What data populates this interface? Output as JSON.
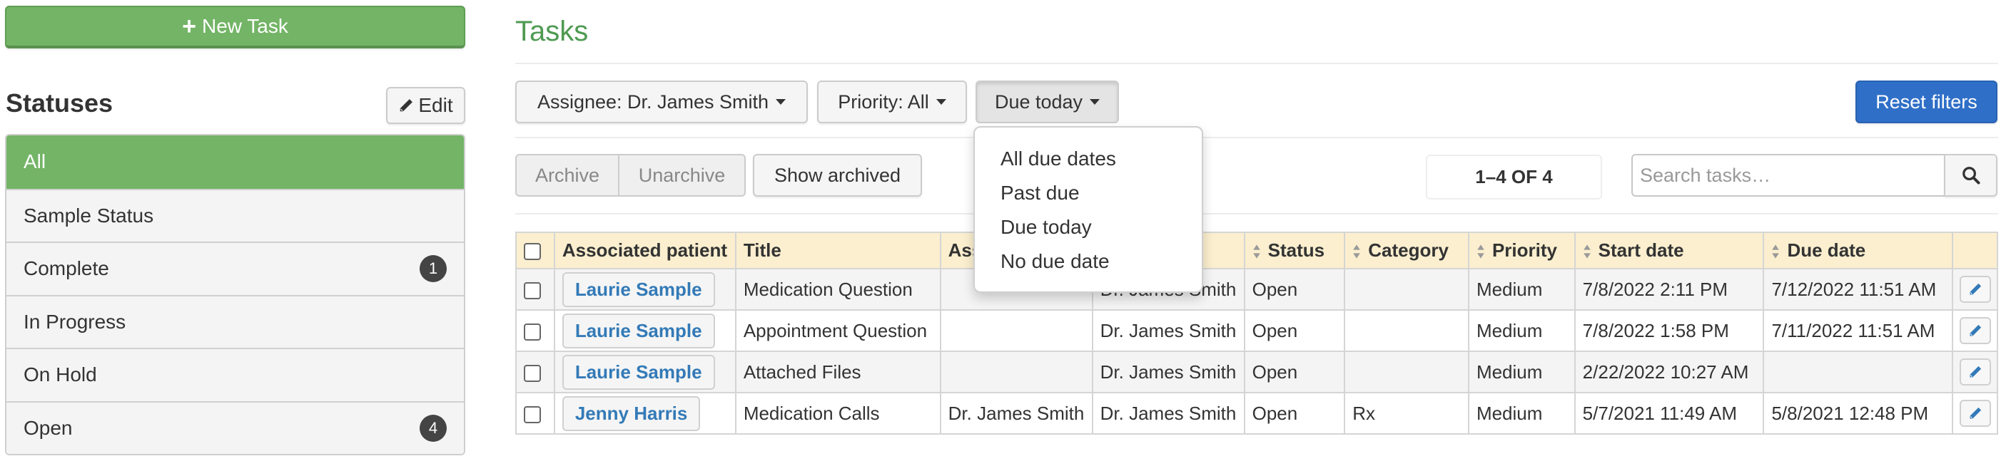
{
  "sidebar": {
    "new_task_label": "New Task",
    "statuses_title": "Statuses",
    "edit_label": "Edit",
    "statuses": [
      {
        "label": "All",
        "count": null,
        "active": true
      },
      {
        "label": "Sample Status",
        "count": null,
        "active": false
      },
      {
        "label": "Complete",
        "count": "1",
        "active": false
      },
      {
        "label": "In Progress",
        "count": null,
        "active": false
      },
      {
        "label": "On Hold",
        "count": null,
        "active": false
      },
      {
        "label": "Open",
        "count": "4",
        "active": false
      }
    ]
  },
  "main": {
    "title": "Tasks",
    "filters": {
      "assignee_label": "Assignee: Dr. James Smith",
      "priority_label": "Priority: All",
      "due_label": "Due today",
      "reset_label": "Reset filters",
      "due_menu": [
        "All due dates",
        "Past due",
        "Due today",
        "No due date"
      ]
    },
    "actions": {
      "archive_label": "Archive",
      "unarchive_label": "Unarchive",
      "show_archived_label": "Show archived"
    },
    "pagination": "1–4 OF 4",
    "search": {
      "placeholder": "Search tasks…",
      "value": ""
    },
    "table": {
      "headers": [
        "Associated patient",
        "Title",
        "Ass",
        "",
        "Status",
        "Category",
        "Priority",
        "Start date",
        "Due date"
      ],
      "rows": [
        {
          "patient": "Laurie Sample",
          "title": "Medication Question",
          "assigned_by": "",
          "assignee": "Dr. James Smith",
          "status": "Open",
          "category": "",
          "priority": "Medium",
          "start": "7/8/2022 2:11 PM",
          "due": "7/12/2022 11:51 AM"
        },
        {
          "patient": "Laurie Sample",
          "title": "Appointment Question",
          "assigned_by": "",
          "assignee": "Dr. James Smith",
          "status": "Open",
          "category": "",
          "priority": "Medium",
          "start": "7/8/2022 1:58 PM",
          "due": "7/11/2022 11:51 AM"
        },
        {
          "patient": "Laurie Sample",
          "title": "Attached Files",
          "assigned_by": "",
          "assignee": "Dr. James Smith",
          "status": "Open",
          "category": "",
          "priority": "Medium",
          "start": "2/22/2022 10:27 AM",
          "due": ""
        },
        {
          "patient": "Jenny Harris",
          "title": "Medication Calls",
          "assigned_by": "Dr. James Smith",
          "assignee": "Dr. James Smith",
          "status": "Open",
          "category": "Rx",
          "priority": "Medium",
          "start": "5/7/2021 11:49 AM",
          "due": "5/8/2021 12:48 PM"
        }
      ]
    }
  },
  "colors": {
    "brand_green": "#73b466",
    "title_green": "#4e9a51",
    "primary_blue": "#2f6fc7",
    "link_blue": "#337ab7",
    "header_yellow": "#fbefcf",
    "badge_dark": "#444444"
  },
  "icons": {
    "new_task": "plus-icon",
    "edit": "pencil-icon",
    "search": "search-icon",
    "sort": "sort-icon",
    "row_edit": "pencil-icon"
  }
}
